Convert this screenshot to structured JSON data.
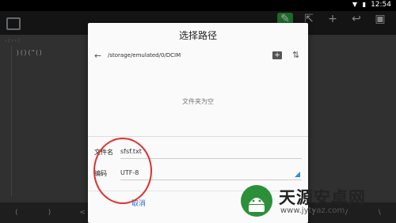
{
  "statusbar": {
    "time": "12:54"
  },
  "editor": {
    "tab_label": "‹ / ‹ ‹ /",
    "code_line": ")()(\"()"
  },
  "keys": [
    "(",
    ")",
    "<",
    ">",
    ",",
    ";",
    "'",
    "\"",
    "(",
    ")",
    "/",
    "\\"
  ],
  "dialog": {
    "title": "选择路径",
    "path": "/storage/emulated/0/DCIM",
    "empty_text": "文件夹为空",
    "filename_label": "文件名",
    "filename_value": "sfsf.txt",
    "encoding_label": "编码",
    "encoding_value": "UTF-8",
    "cancel_label": "取消"
  },
  "watermark": {
    "name": "天源安卓网",
    "url": "www.jytyaz.com"
  },
  "colors": {
    "accent": "#2a8fd4",
    "highlight_circle": "#e0312f",
    "active_tool": "#2ea043"
  }
}
